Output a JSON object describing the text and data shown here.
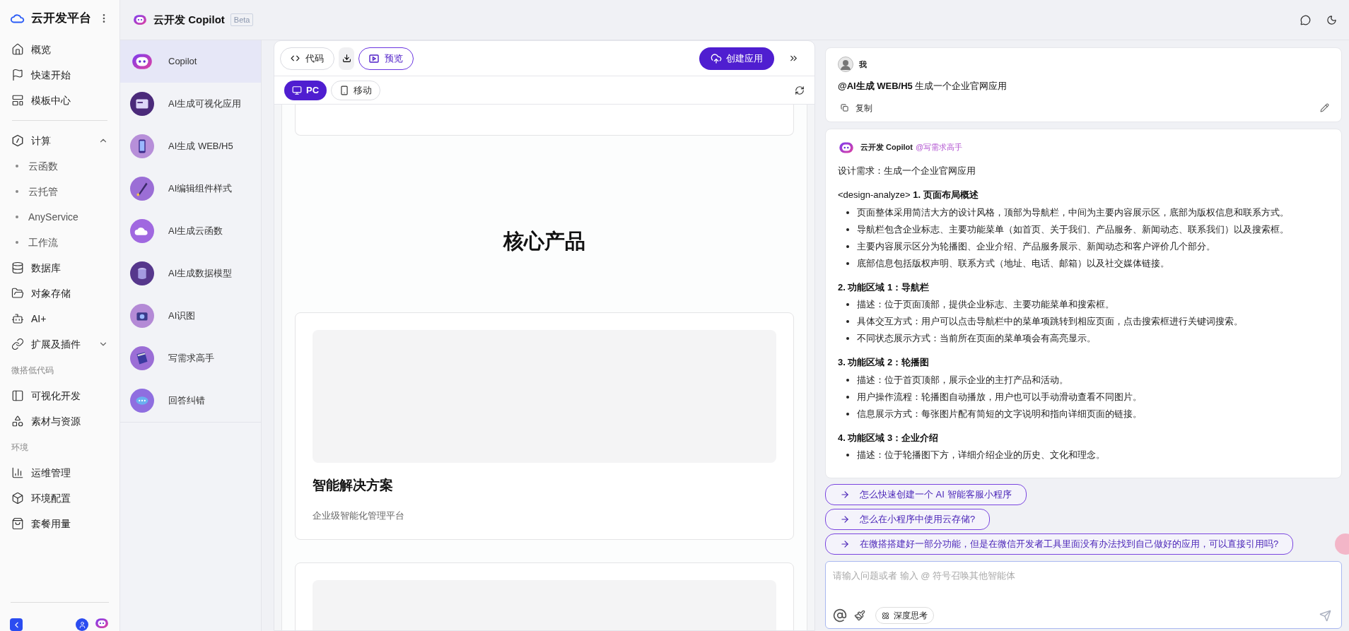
{
  "sidebar": {
    "brand": "云开发平台",
    "items": [
      {
        "kind": "item",
        "label": "概览"
      },
      {
        "kind": "item",
        "label": "快速开始"
      },
      {
        "kind": "item",
        "label": "模板中心"
      },
      {
        "kind": "divider"
      },
      {
        "kind": "group",
        "label": "计算",
        "expanded": true,
        "children": [
          {
            "label": "云函数"
          },
          {
            "label": "云托管"
          },
          {
            "label": "AnyService"
          },
          {
            "label": "工作流"
          }
        ]
      },
      {
        "kind": "item",
        "label": "数据库"
      },
      {
        "kind": "item",
        "label": "对象存储"
      },
      {
        "kind": "item",
        "label": "AI+"
      },
      {
        "kind": "group",
        "label": "扩展及插件",
        "expanded": false
      },
      {
        "kind": "label",
        "label": "微搭低代码"
      },
      {
        "kind": "item",
        "label": "可视化开发"
      },
      {
        "kind": "item",
        "label": "素材与资源"
      },
      {
        "kind": "label",
        "label": "环境"
      },
      {
        "kind": "item",
        "label": "运维管理"
      },
      {
        "kind": "item",
        "label": "环境配置"
      },
      {
        "kind": "item",
        "label": "套餐用量"
      }
    ]
  },
  "header": {
    "title": "云开发 Copilot",
    "badge": "Beta"
  },
  "agents": [
    {
      "label": "Copilot",
      "selected": true
    },
    {
      "label": "AI生成可视化应用",
      "selected": false
    },
    {
      "label": "AI生成 WEB/H5",
      "selected": false
    },
    {
      "label": "AI编辑组件样式",
      "selected": false
    },
    {
      "label": "AI生成云函数",
      "selected": false
    },
    {
      "label": "AI生成数据模型",
      "selected": false
    },
    {
      "label": "AI识图",
      "selected": false
    },
    {
      "label": "写需求高手",
      "selected": false
    },
    {
      "label": "回答纠错",
      "selected": false
    }
  ],
  "workspace": {
    "view_tabs": [
      {
        "label": "代码",
        "selected": false
      },
      {
        "label": "预览",
        "selected": true
      }
    ],
    "create_button": "创建应用",
    "device_tabs": [
      {
        "label": "PC",
        "selected": true
      },
      {
        "label": "移动",
        "selected": false
      }
    ],
    "preview": {
      "section_title": "核心产品",
      "cards": [
        {
          "title": "智能解决方案",
          "subtitle": "企业级智能化管理平台"
        }
      ]
    }
  },
  "chat": {
    "user_message": {
      "author": "我",
      "text": "**@AI生成 WEB/H5** 生成一个企业官网应用",
      "copy_label": "复制"
    },
    "reply": {
      "author": "云开发 Copilot",
      "agent_tag": "@写需求高手",
      "intro": "设计需求：生成一个企业官网应用",
      "sections": [
        {
          "heading": "<design-analyze> **1. 页面布局概述**",
          "bullets": [
            "页面整体采用简洁大方的设计风格，顶部为导航栏，中间为主要内容展示区，底部为版权信息和联系方式。",
            "导航栏包含企业标志、主要功能菜单（如首页、关于我们、产品服务、新闻动态、联系我们）以及搜索框。",
            "主要内容展示区分为轮播图、企业介绍、产品服务展示、新闻动态和客户评价几个部分。",
            "底部信息包括版权声明、联系方式（地址、电话、邮箱）以及社交媒体链接。"
          ]
        },
        {
          "heading": "**2. 功能区域 1：导航栏**",
          "bullets": [
            "描述：位于页面顶部，提供企业标志、主要功能菜单和搜索框。",
            "具体交互方式：用户可以点击导航栏中的菜单项跳转到相应页面，点击搜索框进行关键词搜索。",
            "不同状态展示方式：当前所在页面的菜单项会有高亮显示。"
          ]
        },
        {
          "heading": "**3. 功能区域 2：轮播图**",
          "bullets": [
            "描述：位于首页顶部，展示企业的主打产品和活动。",
            "用户操作流程：轮播图自动播放，用户也可以手动滑动查看不同图片。",
            "信息展示方式：每张图片配有简短的文字说明和指向详细页面的链接。"
          ]
        },
        {
          "heading": "**4. 功能区域 3：企业介绍**",
          "bullets": [
            "描述：位于轮播图下方，详细介绍企业的历史、文化和理念。"
          ]
        }
      ]
    },
    "suggestions": [
      "怎么快速创建一个 AI 智能客服小程序",
      "怎么在小程序中使用云存储?",
      "在微搭搭建好一部分功能，但是在微信开发者工具里面没有办法找到自己做好的应用，可以直接引用吗?"
    ],
    "input": {
      "placeholder": "请输入问题或者 输入 @ 符号召唤其他智能体",
      "deep_think": "深度思考"
    }
  }
}
